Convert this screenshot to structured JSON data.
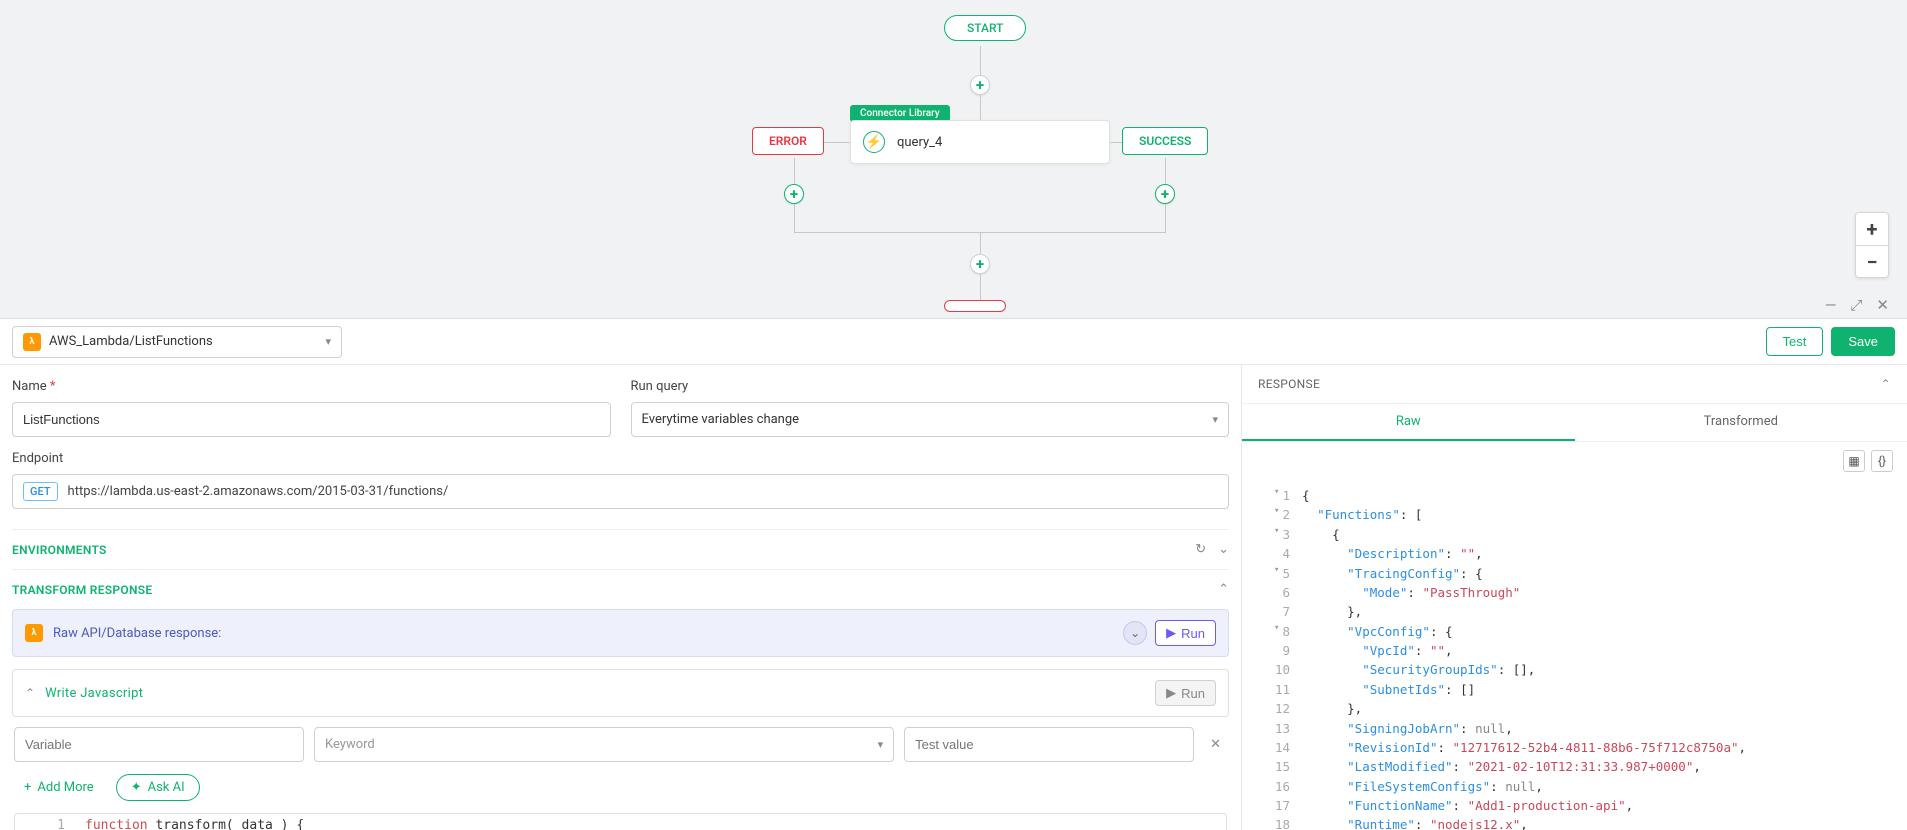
{
  "flow": {
    "start": "START",
    "connectorBadge": "Connector Library",
    "queryName": "query_4",
    "error": "ERROR",
    "success": "SUCCESS"
  },
  "header": {
    "connectorSelected": "AWS_Lambda/ListFunctions",
    "testBtn": "Test",
    "saveBtn": "Save"
  },
  "form": {
    "nameLabel": "Name",
    "nameValue": "ListFunctions",
    "runQueryLabel": "Run query",
    "runQueryValue": "Everytime variables change",
    "endpointLabel": "Endpoint",
    "httpMethod": "GET",
    "endpointUrl": "https://lambda.us-east-2.amazonaws.com/2015-03-31/functions/"
  },
  "sections": {
    "environments": "ENVIRONMENTS",
    "transform": "TRANSFORM RESPONSE",
    "rawResponse": "Raw API/Database response:",
    "run": "Run",
    "writeJs": "Write Javascript",
    "variablePh": "Variable",
    "keywordPh": "Keyword",
    "testValuePh": "Test value",
    "addMore": "Add More",
    "askAi": "Ask AI",
    "codeLine1": "function transform( data ) {"
  },
  "response": {
    "title": "RESPONSE",
    "tabRaw": "Raw",
    "tabTransformed": "Transformed",
    "lines": [
      {
        "n": 1,
        "fold": "▾",
        "indent": 0,
        "text": "{"
      },
      {
        "n": 2,
        "fold": "▾",
        "indent": 1,
        "key": "Functions",
        "after": ": ["
      },
      {
        "n": 3,
        "fold": "▾",
        "indent": 2,
        "text": "{"
      },
      {
        "n": 4,
        "indent": 3,
        "key": "Description",
        "str": "",
        "comma": true
      },
      {
        "n": 5,
        "fold": "▾",
        "indent": 3,
        "key": "TracingConfig",
        "after": ": {"
      },
      {
        "n": 6,
        "indent": 4,
        "key": "Mode",
        "str": "PassThrough"
      },
      {
        "n": 7,
        "indent": 3,
        "text": "},"
      },
      {
        "n": 8,
        "fold": "▾",
        "indent": 3,
        "key": "VpcConfig",
        "after": ": {"
      },
      {
        "n": 9,
        "indent": 4,
        "key": "VpcId",
        "str": "",
        "comma": true
      },
      {
        "n": 10,
        "indent": 4,
        "key": "SecurityGroupIds",
        "after": ": []",
        "comma": true
      },
      {
        "n": 11,
        "indent": 4,
        "key": "SubnetIds",
        "after": ": []"
      },
      {
        "n": 12,
        "indent": 3,
        "text": "},"
      },
      {
        "n": 13,
        "indent": 3,
        "key": "SigningJobArn",
        "nullv": true,
        "comma": true
      },
      {
        "n": 14,
        "indent": 3,
        "key": "RevisionId",
        "str": "12717612-52b4-4811-88b6-75f712c8750a",
        "comma": true
      },
      {
        "n": 15,
        "indent": 3,
        "key": "LastModified",
        "str": "2021-02-10T12:31:33.987+0000",
        "comma": true
      },
      {
        "n": 16,
        "indent": 3,
        "key": "FileSystemConfigs",
        "nullv": true,
        "comma": true
      },
      {
        "n": 17,
        "indent": 3,
        "key": "FunctionName",
        "str": "Add1-production-api",
        "comma": true
      },
      {
        "n": 18,
        "indent": 3,
        "key": "Runtime",
        "str": "nodejs12.x",
        "comma": true
      }
    ]
  }
}
